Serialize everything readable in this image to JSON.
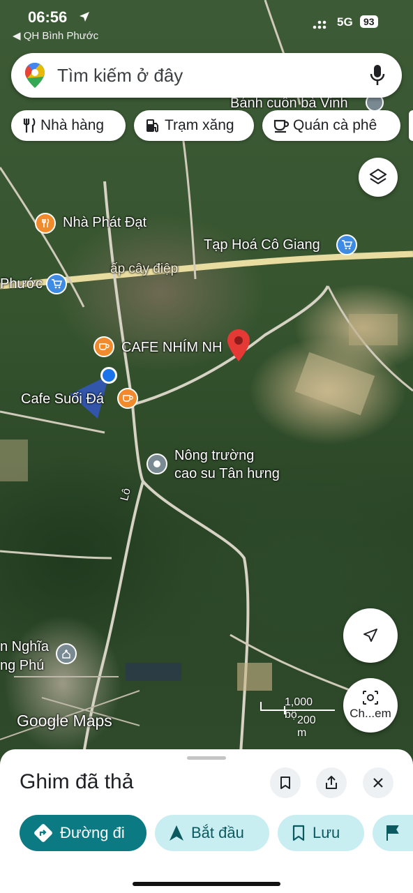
{
  "status_bar": {
    "time": "06:56",
    "back_label": "◀ QH Bình Phước",
    "network": "5G",
    "battery": "93"
  },
  "search": {
    "placeholder": "Tìm kiếm ở đây"
  },
  "chips": [
    {
      "label": "Nhà hàng",
      "icon": "fork-knife-icon"
    },
    {
      "label": "Trạm xăng",
      "icon": "gas-station-icon"
    },
    {
      "label": "Quán cà phê",
      "icon": "coffee-cup-icon"
    }
  ],
  "map": {
    "labels": {
      "banh_cuon": "Bánh cuốn bà Vinh",
      "nha_phat_dat": "Nhà Phát Đạt",
      "tap_hoa": "Tạp Hoá Cô Giang",
      "ap_cay_diep": "ấp cây điệp",
      "phuoc": "Phước",
      "cafe_nhim": "CAFE NHÍM NH",
      "cafe_suoi_da": "Cafe Suối Đá",
      "nong_truong_1": "Nông trường",
      "nong_truong_2": "cao su Tân hưng",
      "lo": "Lô",
      "nghia": "n Nghĩa",
      "ong_phu": "ng Phú"
    },
    "watermark": "Google Maps",
    "scale_top": "1,000 bộ",
    "scale_bottom": "200 m",
    "camera_label": "Ch...em"
  },
  "sheet": {
    "title": "Ghim đã thả",
    "actions": [
      {
        "label": "Đường đi",
        "icon": "directions-icon",
        "style": "primary"
      },
      {
        "label": "Bắt đầu",
        "icon": "navigation-arrow-icon",
        "style": "secondary"
      },
      {
        "label": "Lưu",
        "icon": "bookmark-icon",
        "style": "secondary"
      }
    ]
  },
  "colors": {
    "accent_teal": "#0b7a83",
    "pin_red": "#e53935",
    "poi_orange": "#f08a2a",
    "poi_blue": "#3d8be4",
    "location_blue": "#1a73e8"
  }
}
